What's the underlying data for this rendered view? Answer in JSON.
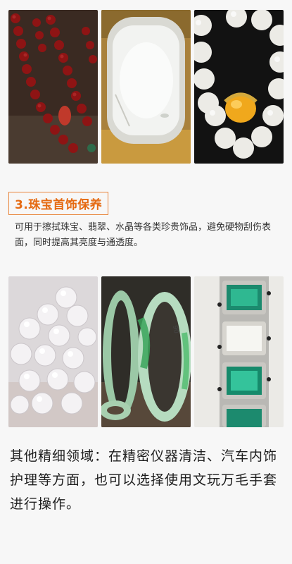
{
  "images": {
    "top": [
      {
        "name": "red-bead-bracelet-photo"
      },
      {
        "name": "white-jade-pendant-photo"
      },
      {
        "name": "white-beads-amber-photo"
      }
    ],
    "mid": [
      {
        "name": "pearls-photo"
      },
      {
        "name": "jade-bangles-photo"
      },
      {
        "name": "emerald-bracelet-photo"
      }
    ]
  },
  "section": {
    "title": "3.珠宝首饰保养",
    "description": "可用于擦拭珠宝、翡翠、水晶等各类珍贵饰品，避免硬物刮伤表面，同时提高其亮度与通透度。"
  },
  "footer": {
    "text": "其他精细领域：在精密仪器清洁、汽车内饰护理等方面，也可以选择使用文玩万毛手套进行操作。"
  },
  "colors": {
    "accent": "#e8843a",
    "accent_text": "#e56a12",
    "background": "#f7f7f7"
  }
}
